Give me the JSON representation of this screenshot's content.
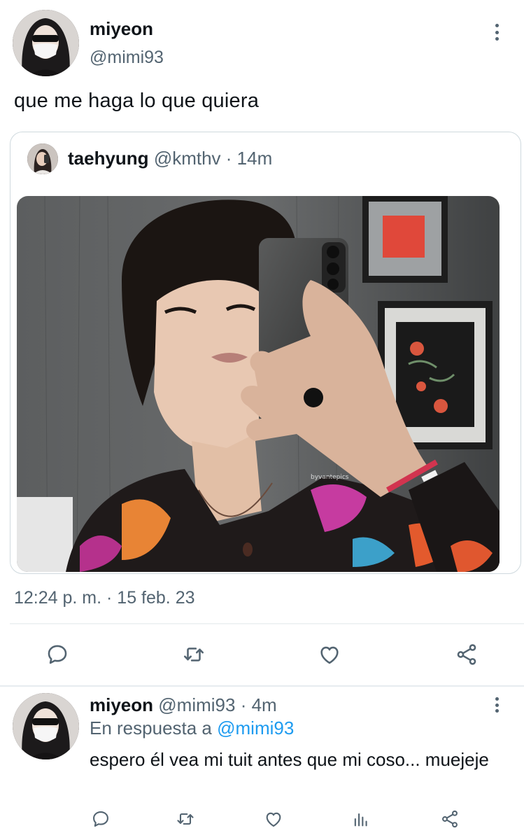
{
  "tweet": {
    "author_name": "miyeon",
    "author_handle": "@mimi93",
    "text": "que me haga lo que quiera",
    "timestamp": "12:24 p. m. · 15 feb. 23",
    "quoted": {
      "author_name": "taehyung",
      "author_handle": "@kmthv",
      "time": "· 14m",
      "media_watermark": "byvantepics"
    },
    "actions": [
      "reply-icon",
      "retweet-icon",
      "like-icon",
      "share-icon"
    ]
  },
  "reply": {
    "author_name": "miyeon",
    "author_handle": "@mimi93",
    "time": "· 4m",
    "reply_prefix": "En respuesta a",
    "reply_mention": "@mimi93",
    "text": "espero él vea mi tuit antes que mi coso... muejeje",
    "actions": [
      "reply-icon",
      "retweet-icon",
      "like-icon",
      "analytics-icon",
      "share-icon"
    ]
  },
  "colors": {
    "text_primary": "#0f1419",
    "text_secondary": "#536471",
    "accent": "#1d9bf0",
    "border": "#cfd9de"
  }
}
